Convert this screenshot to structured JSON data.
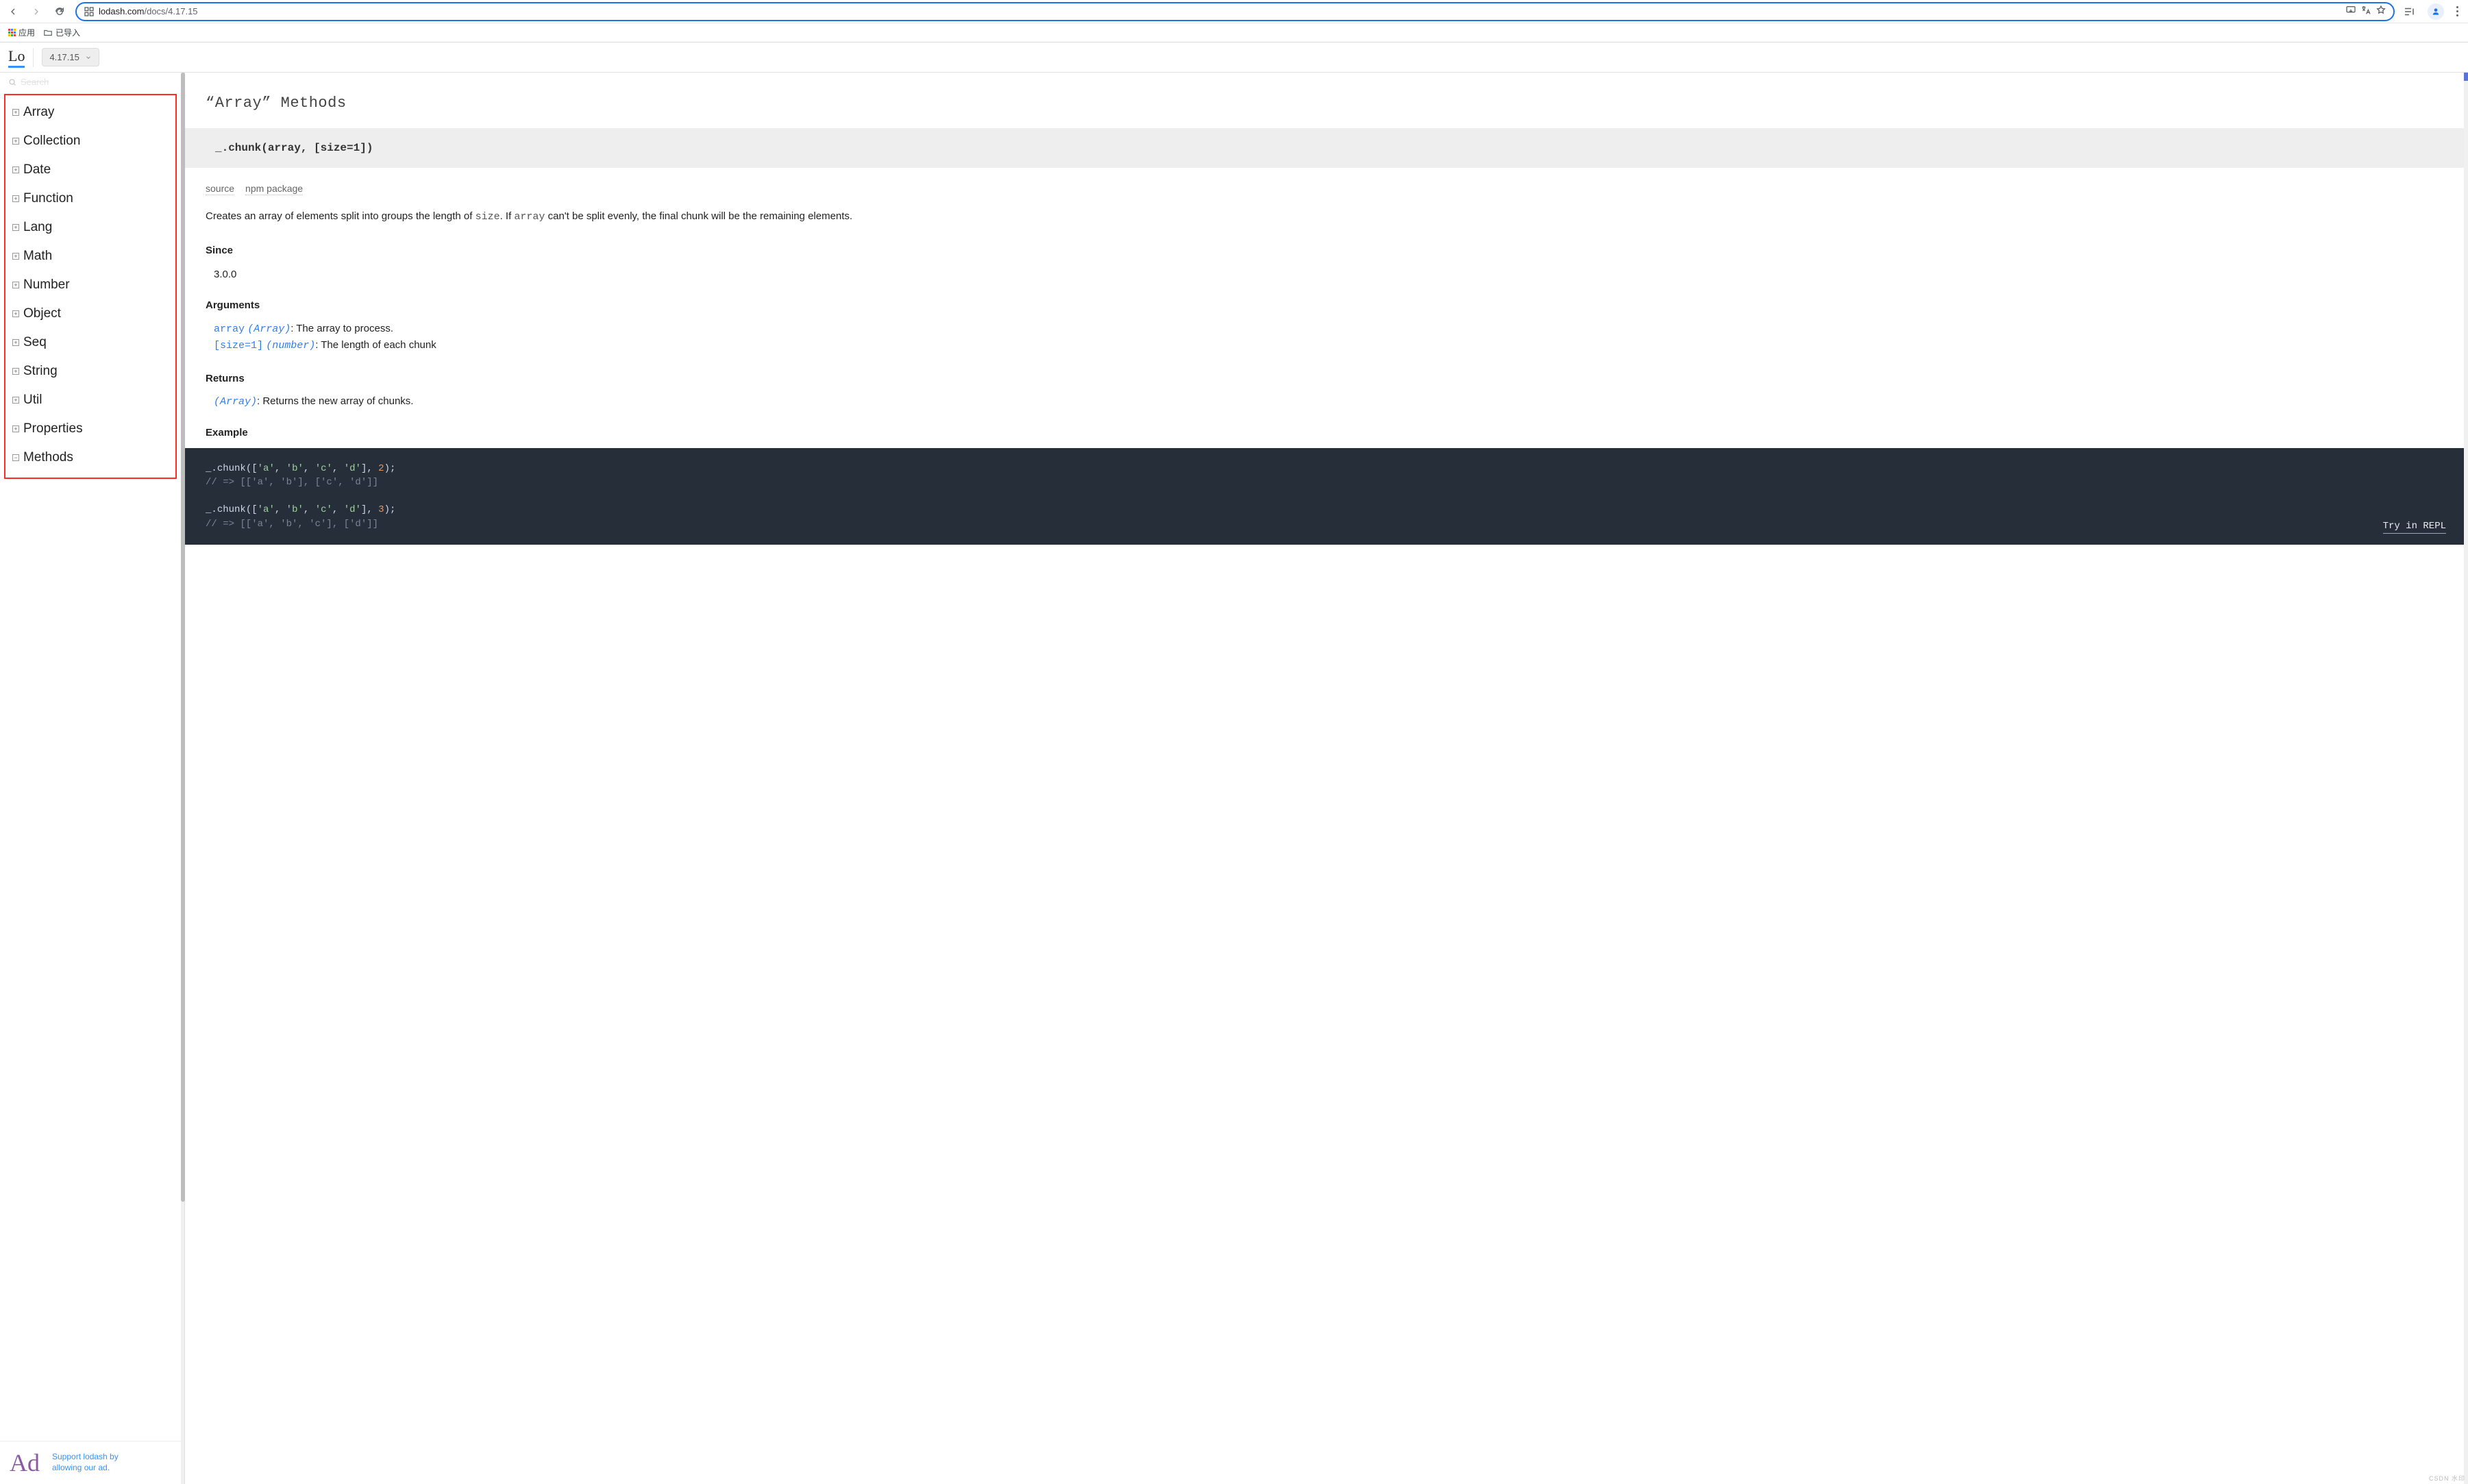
{
  "browser": {
    "url_domain": "lodash.com",
    "url_path": "/docs/4.17.15",
    "bookmarks": {
      "apps": "应用",
      "imported": "已导入"
    }
  },
  "header": {
    "logo": "Lo",
    "version": "4.17.15"
  },
  "sidebar": {
    "search_placeholder": "Search",
    "categories": [
      {
        "label": "Array",
        "expanded": false
      },
      {
        "label": "Collection",
        "expanded": false
      },
      {
        "label": "Date",
        "expanded": false
      },
      {
        "label": "Function",
        "expanded": false
      },
      {
        "label": "Lang",
        "expanded": false
      },
      {
        "label": "Math",
        "expanded": false
      },
      {
        "label": "Number",
        "expanded": false
      },
      {
        "label": "Object",
        "expanded": false
      },
      {
        "label": "Seq",
        "expanded": false
      },
      {
        "label": "String",
        "expanded": false
      },
      {
        "label": "Util",
        "expanded": false
      },
      {
        "label": "Properties",
        "expanded": false
      },
      {
        "label": "Methods",
        "expanded": true
      }
    ],
    "ad": "Ad",
    "support_line1": "Support lodash by",
    "support_line2": "allowing our ad."
  },
  "doc": {
    "section_title": "“Array” Methods",
    "signature": "_.chunk(array, [size=1])",
    "source_link": "source",
    "npm_link": "npm package",
    "description_pre": "Creates an array of elements split into groups the length of ",
    "description_code1": "size",
    "description_mid": ". If ",
    "description_code2": "array",
    "description_post": " can't be split evenly, the final chunk will be the remaining elements.",
    "since_heading": "Since",
    "since_value": "3.0.0",
    "arguments_heading": "Arguments",
    "args": [
      {
        "name": "array",
        "type": "(Array)",
        "desc": ": The array to process."
      },
      {
        "name": "[size=1]",
        "type": "(number)",
        "desc": ": The length of each chunk"
      }
    ],
    "returns_heading": "Returns",
    "returns_type": "(Array)",
    "returns_desc": ": Returns the new array of chunks.",
    "example_heading": "Example",
    "example_lines": [
      {
        "kind": "code",
        "pre": "_.chunk([",
        "items": [
          "'a'",
          "'b'",
          "'c'",
          "'d'"
        ],
        "suffix_num": "2",
        "tail": ");"
      },
      {
        "kind": "comment",
        "text": "// => [['a', 'b'], ['c', 'd']]"
      },
      {
        "kind": "blank"
      },
      {
        "kind": "code",
        "pre": "_.chunk([",
        "items": [
          "'a'",
          "'b'",
          "'c'",
          "'d'"
        ],
        "suffix_num": "3",
        "tail": ");"
      },
      {
        "kind": "comment",
        "text": "// => [['a', 'b', 'c'], ['d']]"
      }
    ],
    "try_repl": "Try in REPL"
  },
  "corner": "CSDN 水印"
}
